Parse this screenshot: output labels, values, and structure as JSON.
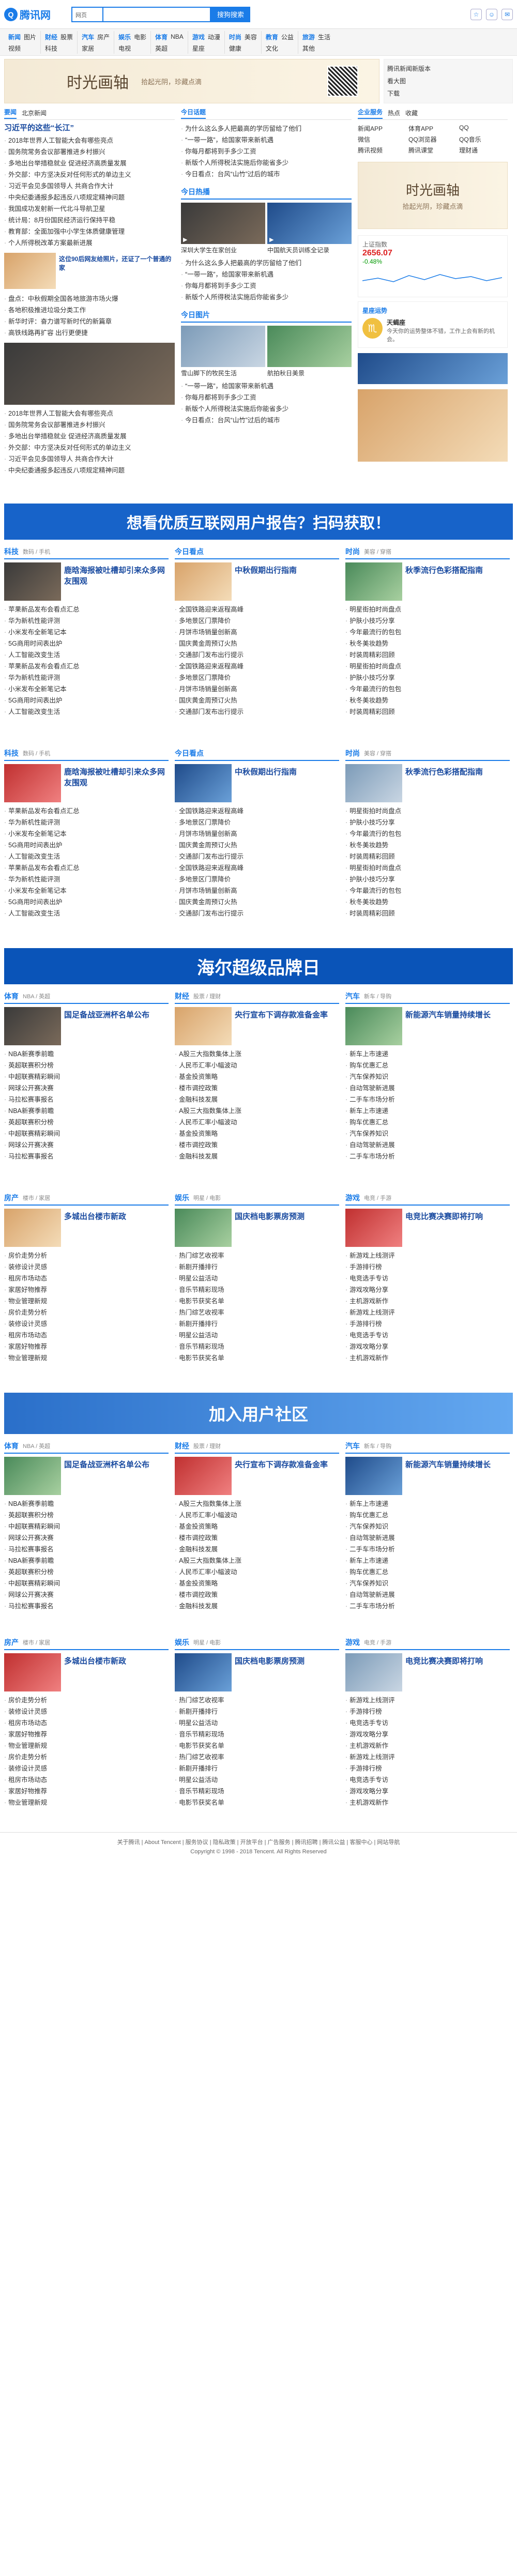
{
  "header": {
    "logo_text": "腾讯网",
    "search_select": "网页",
    "search_placeholder": "",
    "search_button": "搜狗搜索"
  },
  "nav": [
    [
      "新闻",
      "图片",
      "视频"
    ],
    [
      "财经",
      "股票",
      "科技"
    ],
    [
      "汽车",
      "房产",
      "家居"
    ],
    [
      "娱乐",
      "电影",
      "电视"
    ],
    [
      "体育",
      "NBA",
      "英超"
    ],
    [
      "游戏",
      "动漫",
      "星座"
    ],
    [
      "时尚",
      "美容",
      "健康"
    ],
    [
      "教育",
      "公益",
      "文化"
    ],
    [
      "旅游",
      "生活",
      "其他"
    ]
  ],
  "banner": {
    "title": "时光画轴",
    "subtitle": "拾起光阴，珍藏点滴",
    "side_items": [
      "腾讯新闻新版本",
      "看大图",
      "下载"
    ]
  },
  "top": {
    "tabs": [
      "要闻",
      "北京新闻"
    ],
    "headline": "习近平的这些“长江”",
    "news": [
      "2018年世界人工智能大会有哪些亮点",
      "国务院常务会议部署推进乡村振兴",
      "多地出台举措稳就业 促进经济高质量发展",
      "外交部：中方坚决反对任何形式的单边主义",
      "习近平会见多国领导人 共商合作大计",
      "中央纪委通报多起违反八项规定精神问题",
      "我国成功发射新一代北斗导航卫星",
      "统计局：8月份国民经济运行保持平稳",
      "教育部：全面加强中小学生体质健康管理",
      "个人所得税改革方案最新进展"
    ],
    "pic_caption": "这位90后网友给照片，还证了一个普通的家",
    "more_news": [
      "盘点：中秋假期全国各地旅游市场火爆",
      "各地积极推进垃圾分类工作",
      "新华时评：奋力谱写新时代的新篇章",
      "高铁线路再扩容 出行更便捷"
    ]
  },
  "today": {
    "title": "今日话题",
    "items": [
      "为什么这么多人把最高的学历留给了他们",
      "“一带一路”，给国家带来新机遇",
      "你每月都将到手多少工资",
      "新版个人所得税法实施后你能省多少",
      "今日看点：台风“山竹”过后的城市"
    ],
    "video_title": "今日热播",
    "videos": [
      "深圳大学生在家创业",
      "中国航天员训练全记录"
    ],
    "pic_title": "今日图片",
    "pics": [
      "雪山脚下的牧民生活",
      "航拍秋日美景"
    ]
  },
  "right": {
    "tabs": [
      "企业服务",
      "热点",
      "收藏"
    ],
    "links": [
      "新闻APP",
      "体育APP",
      "QQ",
      "微信",
      "QQ浏览器",
      "QQ音乐",
      "腾讯视频",
      "腾讯课堂",
      "理财通"
    ],
    "stock_label": "上证指数",
    "stock_value": "2656.07",
    "stock_change": "-0.48%",
    "horoscope_title": "星座运势",
    "horoscope_name": "天蝎座",
    "horoscope_text": "今天你的运势整体不错，工作上会有新的机会。"
  },
  "ad1": {
    "text": "想看优质互联网用户报告？扫码获取！"
  },
  "sections": [
    {
      "title": "科技",
      "sub": "数码 / 手机",
      "headline": "鹿晗海报被吐槽却引来众多网友围观",
      "news": [
        "苹果新品发布会看点汇总",
        "华为新机性能评测",
        "小米发布全新笔记本",
        "5G商用时间表出炉",
        "人工智能改变生活"
      ]
    },
    {
      "title": "今日看点",
      "sub": "",
      "headline": "中秋假期出行指南",
      "news": [
        "全国铁路迎来返程高峰",
        "多地景区门票降价",
        "月饼市场销量创新高",
        "国庆黄金周预订火热",
        "交通部门发布出行提示"
      ]
    },
    {
      "title": "时尚",
      "sub": "美容 / 穿搭",
      "headline": "秋季流行色彩搭配指南",
      "news": [
        "明星街拍时尚盘点",
        "护肤小技巧分享",
        "今年最流行的包包",
        "秋冬美妆趋势",
        "时装周精彩回顾"
      ]
    }
  ],
  "bottom_sections": [
    {
      "title": "体育",
      "sub": "NBA / 英超",
      "headline": "国足备战亚洲杯名单公布",
      "news": [
        "NBA新赛季前瞻",
        "英超联赛积分榜",
        "中超联赛精彩瞬间",
        "网球公开赛决赛",
        "马拉松赛事报名"
      ]
    },
    {
      "title": "财经",
      "sub": "股票 / 理财",
      "headline": "央行宣布下调存款准备金率",
      "news": [
        "A股三大指数集体上涨",
        "人民币汇率小幅波动",
        "基金投资策略",
        "楼市调控政策",
        "金融科技发展"
      ]
    },
    {
      "title": "汽车",
      "sub": "新车 / 导购",
      "headline": "新能源汽车销量持续增长",
      "news": [
        "新车上市速递",
        "购车优惠汇总",
        "汽车保养知识",
        "自动驾驶新进展",
        "二手车市场分析"
      ]
    },
    {
      "title": "房产",
      "sub": "楼市 / 家居",
      "headline": "多城出台楼市新政",
      "news": [
        "房价走势分析",
        "装修设计灵感",
        "租房市场动态",
        "家居好物推荐",
        "物业管理新规"
      ]
    },
    {
      "title": "娱乐",
      "sub": "明星 / 电影",
      "headline": "国庆档电影票房预测",
      "news": [
        "热门综艺收视率",
        "新剧开播排行",
        "明星公益活动",
        "音乐节精彩现场",
        "电影节获奖名单"
      ]
    },
    {
      "title": "游戏",
      "sub": "电竞 / 手游",
      "headline": "电竞比赛决赛即将打响",
      "news": [
        "新游戏上线测评",
        "手游排行榜",
        "电竞选手专访",
        "游戏攻略分享",
        "主机游戏新作"
      ]
    }
  ],
  "ad2": {
    "text": "海尔超级品牌日"
  },
  "ad3": {
    "text": "加入用户社区"
  },
  "footer": {
    "links": "关于腾讯 | About Tencent | 服务协议 | 隐私政策 | 开放平台 | 广告服务 | 腾讯招聘 | 腾讯公益 | 客服中心 | 网站导航",
    "copyright": "Copyright © 1998 - 2018 Tencent. All Rights Reserved"
  },
  "colors": {
    "accent": "#1a7ce8",
    "ad1": "#1763c9",
    "ad2": "#0a54b8"
  }
}
